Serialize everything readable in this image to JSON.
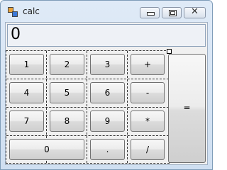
{
  "window": {
    "title": "calc"
  },
  "titlebar": {
    "minimize_icon": "minimize-icon",
    "maximize_icon": "maximize-icon",
    "close_icon": "close-icon",
    "close_glyph": "✕"
  },
  "display": {
    "value": "0"
  },
  "keys": {
    "one": "1",
    "two": "2",
    "three": "3",
    "plus": "+",
    "four": "4",
    "five": "5",
    "six": "6",
    "minus": "-",
    "seven": "7",
    "eight": "8",
    "nine": "9",
    "multiply": "*",
    "zero": "0",
    "dot": ".",
    "divide": "/",
    "equals": "="
  }
}
